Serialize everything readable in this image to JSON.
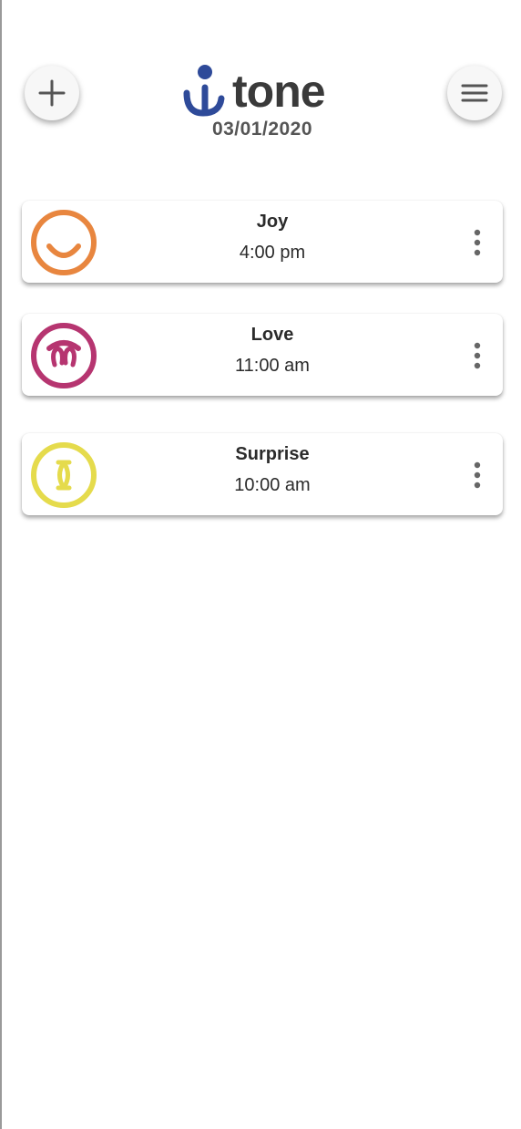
{
  "app": {
    "name": "tone",
    "date": "03/01/2020"
  },
  "header": {
    "add_icon": "plus-icon",
    "menu_icon": "hamburger-menu-icon"
  },
  "entries": [
    {
      "emotion": "Joy",
      "time": "4:00 pm",
      "icon": "joy-face-icon",
      "color": "#E8863F"
    },
    {
      "emotion": "Love",
      "time": "11:00 am",
      "icon": "love-face-icon",
      "color": "#B63570"
    },
    {
      "emotion": "Surprise",
      "time": "10:00 am",
      "icon": "surprise-face-icon",
      "color": "#E5DB4C"
    }
  ],
  "colors": {
    "logo_blue": "#2E4A99",
    "text_dark": "#2b2b2b"
  }
}
